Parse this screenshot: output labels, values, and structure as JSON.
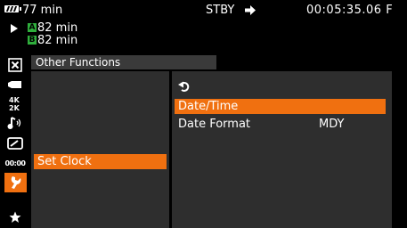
{
  "status": {
    "battery_time": "77 min",
    "card_a_label": "A",
    "card_a_time": "82 min",
    "card_b_label": "B",
    "card_b_time": "82 min",
    "mode": "STBY",
    "timecode": "00:05:35.06 F"
  },
  "sidebar": {
    "icons": [
      "close-icon",
      "camera-icon",
      "resolution-4k-icon",
      "audio-icon",
      "display-icon",
      "timecode-icon",
      "wrench-icon",
      "star-icon"
    ],
    "timecode_icon_text": "00:00",
    "selected": "wrench-icon"
  },
  "menu": {
    "title": "Other Functions",
    "left_items": [
      {
        "label": "Set Clock",
        "selected": true
      }
    ],
    "back_symbol": "⮌",
    "right_items": [
      {
        "label": "Date/Time",
        "value": "",
        "selected": true
      },
      {
        "label": "Date Format",
        "value": "MDY",
        "selected": false
      }
    ]
  },
  "colors": {
    "highlight": "#f07010",
    "card_badge": "#2fae3c",
    "panel": "#2e2e2e",
    "title_bar": "#3a3a3a"
  }
}
